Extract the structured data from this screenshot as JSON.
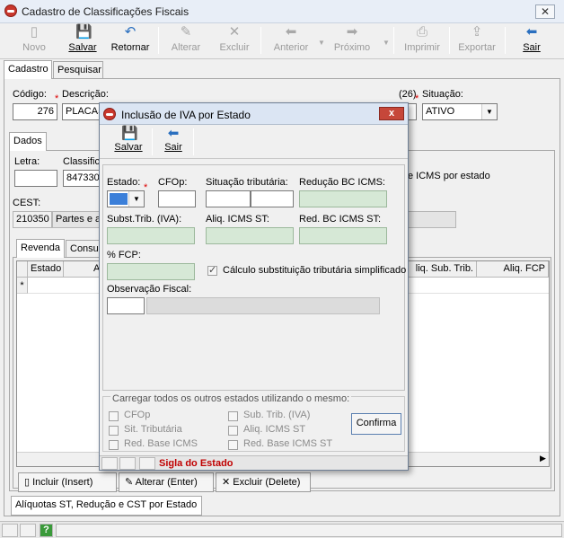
{
  "window": {
    "title": "Cadastro de Classificações Fiscais"
  },
  "toolbar": {
    "novo": "Novo",
    "salvar": "Salvar",
    "retornar": "Retornar",
    "alterar": "Alterar",
    "excluir": "Excluir",
    "anterior": "Anterior",
    "proximo": "Próximo",
    "imprimir": "Imprimir",
    "exportar": "Exportar",
    "sair": "Sair"
  },
  "tabs": {
    "cadastro": "Cadastro",
    "pesquisar": "Pesquisar"
  },
  "form": {
    "codigo_label": "Código:",
    "codigo_value": "276",
    "descricao_label": "Descrição:",
    "descricao_value": "PLACAS",
    "desc_count": "(26)",
    "situacao_label": "Situação:",
    "situacao_value": "ATIVO"
  },
  "dados_tab": "Dados",
  "dados": {
    "letra_label": "Letra:",
    "classif_label": "Classific",
    "classif_value": "847330",
    "icms_estado_text": "e ICMS por estado",
    "cest_label": "CEST:",
    "cest_code": "210350",
    "cest_desc": "Partes e ac"
  },
  "subtabs": {
    "revenda": "Revenda",
    "consumo": "Consu"
  },
  "grid": {
    "columns": [
      "Estado",
      "A",
      "liq. Sub. Trib.",
      "Aliq. FCP"
    ],
    "row_marker": "*"
  },
  "bottom_buttons": {
    "incluir": "Incluir (Insert)",
    "alterar": "Alterar (Enter)",
    "excluir": "Excluir (Delete)"
  },
  "bottom_tab": "Alíquotas ST, Redução e CST por Estado",
  "status_icon": "?",
  "dialog": {
    "title": "Inclusão de IVA por Estado",
    "close": "x",
    "salvar": "Salvar",
    "sair": "Sair",
    "estado_label": "Estado:",
    "cfop_label": "CFOp:",
    "situacao_trib_label": "Situação tributária:",
    "reducao_bc_label": "Redução BC ICMS:",
    "subst_trib_label": "Subst.Trib. (IVA):",
    "aliq_icms_st_label": "Aliq. ICMS ST:",
    "red_bc_st_label": "Red. BC ICMS ST:",
    "fcp_label": "% FCP:",
    "calculo_st_label": "Cálculo substituição tributária simplificado",
    "calculo_st_checked": true,
    "obs_label": "Observação Fiscal:",
    "carregar_title": "Carregar todos os outros estados utilizando o mesmo:",
    "opts_left": [
      "CFOp",
      "Sit. Tributária",
      "Red. Base ICMS"
    ],
    "opts_right": [
      "Sub. Trib. (IVA)",
      "Aliq. ICMS ST",
      "Red. Base ICMS ST"
    ],
    "confirma": "Confirma",
    "status_text": "Sigla do Estado"
  }
}
